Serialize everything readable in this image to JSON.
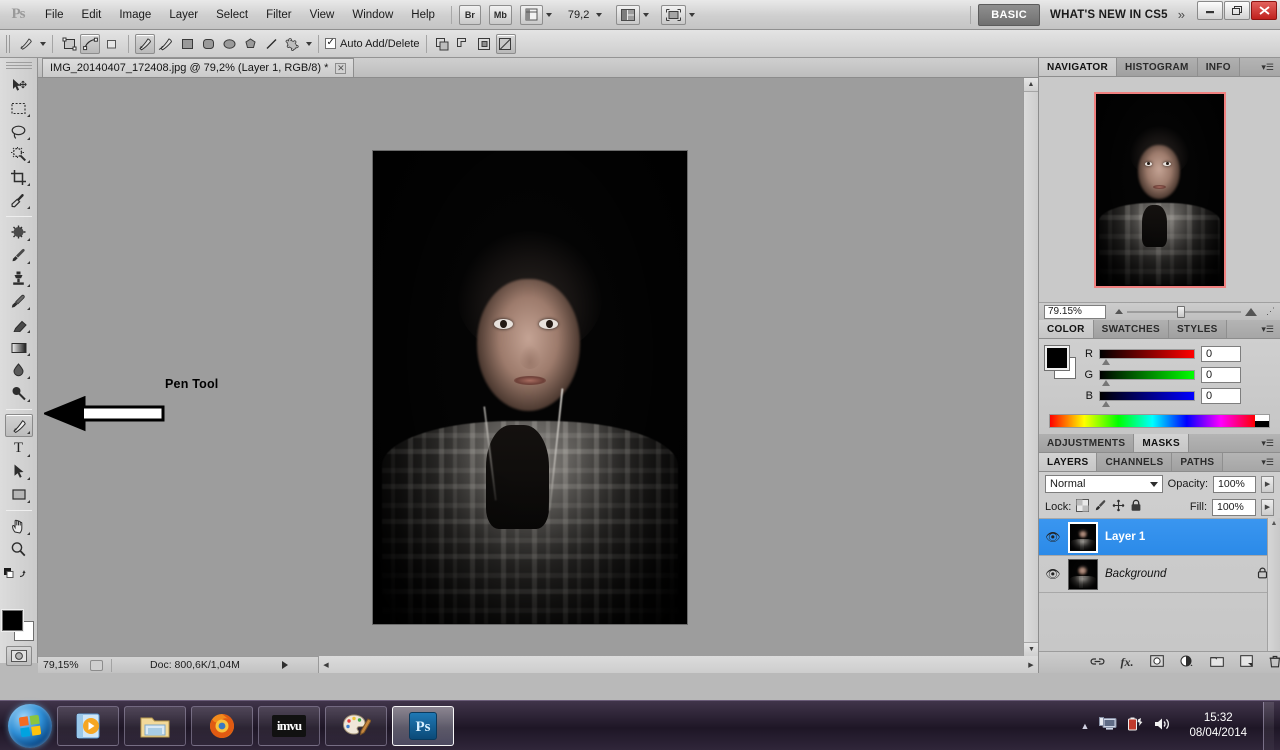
{
  "app": {
    "logo": "Ps",
    "menus": [
      "File",
      "Edit",
      "Image",
      "Layer",
      "Select",
      "Filter",
      "View",
      "Window",
      "Help"
    ],
    "quick_buttons": [
      {
        "name": "bridge",
        "label": "Br"
      },
      {
        "name": "mini-bridge",
        "label": "Mb"
      },
      {
        "name": "view-extras",
        "label": "▤"
      }
    ],
    "zoom_value": "79,2",
    "arrange_icon": "arrange-documents-icon",
    "screen_mode_icon": "screen-mode-icon",
    "workspace_chip": "BASIC",
    "whats_new": "WHAT'S NEW IN CS5",
    "more_chevron": "»",
    "window_buttons": {
      "minimize": "–",
      "restore": "❐",
      "close": "✕"
    }
  },
  "options_bar": {
    "tool_preset_icon": "pen-tool-preset-icon",
    "mode_buttons": [
      "shape-layers-icon",
      "paths-icon",
      "fill-pixels-icon"
    ],
    "shape_tools": [
      "pen-icon",
      "freeform-pen-icon",
      "rectangle-icon",
      "rounded-rectangle-icon",
      "ellipse-icon",
      "polygon-icon",
      "line-icon",
      "custom-shape-icon"
    ],
    "auto_add_delete": "Auto Add/Delete",
    "path_ops": [
      "add-to-path-icon",
      "subtract-from-path-icon",
      "intersect-path-icon",
      "exclude-path-icon"
    ]
  },
  "toolbox": {
    "tools": [
      {
        "name": "move-tool",
        "glyph": "⬉",
        "has_submenu": false,
        "active": false
      },
      {
        "name": "rectangular-marquee-tool",
        "glyph": "⬚",
        "has_submenu": true,
        "active": false
      },
      {
        "name": "lasso-tool",
        "glyph": "◯",
        "has_submenu": true,
        "active": false
      },
      {
        "name": "quick-selection-tool",
        "glyph": "❁",
        "has_submenu": true,
        "active": false
      },
      {
        "name": "crop-tool",
        "glyph": "⌗",
        "has_submenu": true,
        "active": false
      },
      {
        "name": "eyedropper-tool",
        "glyph": "✒",
        "has_submenu": true,
        "active": false
      },
      {
        "name": "spot-healing-brush-tool",
        "glyph": "⌘",
        "has_submenu": true,
        "active": false
      },
      {
        "name": "brush-tool",
        "glyph": "✎",
        "has_submenu": true,
        "active": false
      },
      {
        "name": "clone-stamp-tool",
        "glyph": "⚓",
        "has_submenu": true,
        "active": false
      },
      {
        "name": "history-brush-tool",
        "glyph": "✍",
        "has_submenu": true,
        "active": false
      },
      {
        "name": "eraser-tool",
        "glyph": "▱",
        "has_submenu": true,
        "active": false
      },
      {
        "name": "gradient-tool",
        "glyph": "■",
        "has_submenu": true,
        "active": false
      },
      {
        "name": "blur-tool",
        "glyph": "◖",
        "has_submenu": true,
        "active": false
      },
      {
        "name": "dodge-tool",
        "glyph": "⚲",
        "has_submenu": true,
        "active": false
      },
      {
        "name": "pen-tool",
        "glyph": "✑",
        "has_submenu": true,
        "active": true
      },
      {
        "name": "horizontal-type-tool",
        "glyph": "T",
        "has_submenu": true,
        "active": false
      },
      {
        "name": "path-selection-tool",
        "glyph": "➤",
        "has_submenu": true,
        "active": false
      },
      {
        "name": "rectangle-tool",
        "glyph": "▭",
        "has_submenu": true,
        "active": false
      },
      {
        "name": "hand-tool",
        "glyph": "✋",
        "has_submenu": true,
        "active": false
      },
      {
        "name": "zoom-tool",
        "glyph": "⌕",
        "has_submenu": false,
        "active": false
      }
    ],
    "foreground_color": "#000000",
    "background_color": "#ffffff",
    "quick_mask_icon": "quick-mask-mode-icon"
  },
  "document": {
    "tab_title": "IMG_20140407_172408.jpg @ 79,2% (Layer 1, RGB/8) *",
    "tab_close": "✕",
    "status": {
      "zoom": "79,15%",
      "doc_size": "Doc: 800,6K/1,04M"
    }
  },
  "annotation": {
    "label": "Pen Tool",
    "arrow": "left-arrow-annotation"
  },
  "navigator": {
    "tabs": [
      "NAVIGATOR",
      "HISTOGRAM",
      "INFO"
    ],
    "active_tab": "NAVIGATOR",
    "zoom_value": "79.15%",
    "view_box_color": "#f0807f",
    "menu_icon": "panel-menu-icon"
  },
  "color_panel": {
    "tabs": [
      "COLOR",
      "SWATCHES",
      "STYLES"
    ],
    "active_tab": "COLOR",
    "channels": [
      {
        "label": "R",
        "value": "0"
      },
      {
        "label": "G",
        "value": "0"
      },
      {
        "label": "B",
        "value": "0"
      }
    ],
    "foreground": "#000000",
    "background": "#ffffff"
  },
  "adjustments_panel": {
    "tabs": [
      "ADJUSTMENTS",
      "MASKS"
    ],
    "active_tab": "MASKS"
  },
  "layers_panel": {
    "tabs": [
      "LAYERS",
      "CHANNELS",
      "PATHS"
    ],
    "active_tab": "LAYERS",
    "blend_mode": "Normal",
    "opacity_label": "Opacity:",
    "opacity_value": "100%",
    "lock_label": "Lock:",
    "lock_icons": [
      "lock-transparent-pixels-icon",
      "lock-image-pixels-icon",
      "lock-position-icon",
      "lock-all-icon"
    ],
    "fill_label": "Fill:",
    "fill_value": "100%",
    "layers": [
      {
        "name": "Layer 1",
        "selected": true,
        "visible": true,
        "locked": false
      },
      {
        "name": "Background",
        "selected": false,
        "visible": true,
        "locked": true
      }
    ],
    "footer_icons": [
      "link-layers-icon",
      "layer-style-icon",
      "add-layer-mask-icon",
      "new-adjustment-layer-icon",
      "new-group-icon",
      "new-layer-icon",
      "delete-layer-icon"
    ],
    "footer_glyphs": [
      "⚭",
      "𝑓𝑥",
      "▣",
      "◑",
      "▭",
      "❐",
      "☒"
    ]
  },
  "taskbar": {
    "start": "windows-start-orb",
    "items": [
      {
        "name": "windows-media-player-taskbar-icon",
        "active": false
      },
      {
        "name": "windows-explorer-taskbar-icon",
        "active": false
      },
      {
        "name": "firefox-taskbar-icon",
        "active": false
      },
      {
        "name": "imvu-taskbar-icon",
        "label": "imvu",
        "active": false
      },
      {
        "name": "paint-taskbar-icon",
        "active": false
      },
      {
        "name": "photoshop-taskbar-icon",
        "label": "Ps",
        "active": true
      }
    ],
    "tray": {
      "show_hidden": "▲",
      "icons": [
        "network-tray-icon",
        "battery-tray-icon",
        "volume-tray-icon"
      ],
      "time": "15:32",
      "date": "08/04/2014"
    }
  }
}
